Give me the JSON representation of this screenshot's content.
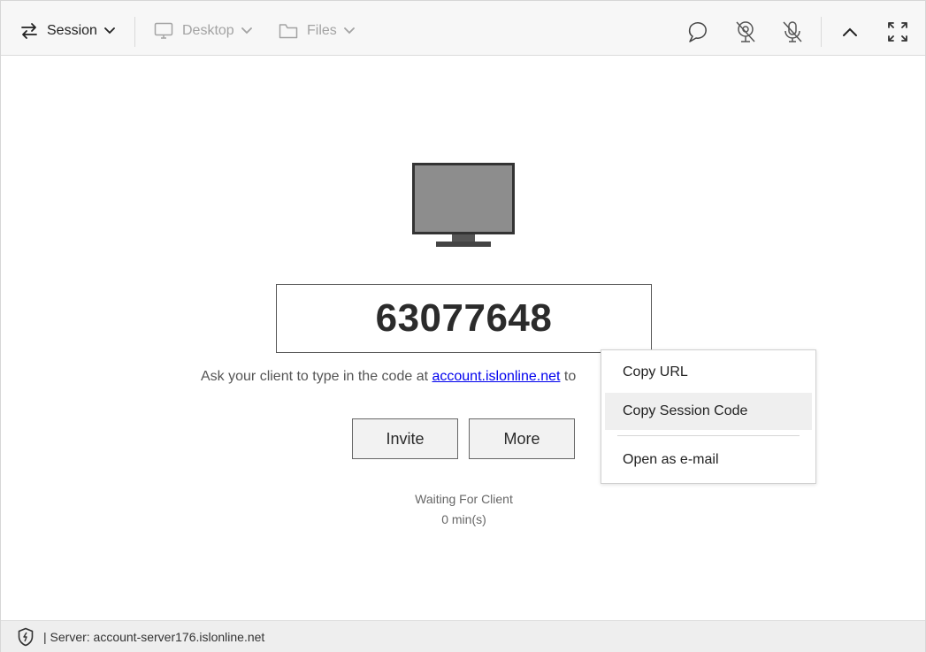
{
  "toolbar": {
    "session_label": "Session",
    "desktop_label": "Desktop",
    "files_label": "Files",
    "icons": [
      "chat-icon",
      "webcam-off-icon",
      "microphone-off-icon",
      "collapse-up-icon",
      "fullscreen-icon"
    ]
  },
  "session": {
    "code": "63077648",
    "instruction_prefix": "Ask your client to type in the code at ",
    "instruction_link": "account.islonline.net",
    "instruction_suffix": " to"
  },
  "buttons": {
    "invite": "Invite",
    "more": "More"
  },
  "status": {
    "state": "Waiting For Client",
    "elapsed": "0 min(s)"
  },
  "context_menu": {
    "items": [
      {
        "label": "Copy URL"
      },
      {
        "label": "Copy Session Code",
        "highlighted": true
      },
      {
        "label": "Open as e-mail"
      }
    ]
  },
  "footer": {
    "server_text": "| Server: account-server176.islonline.net"
  }
}
